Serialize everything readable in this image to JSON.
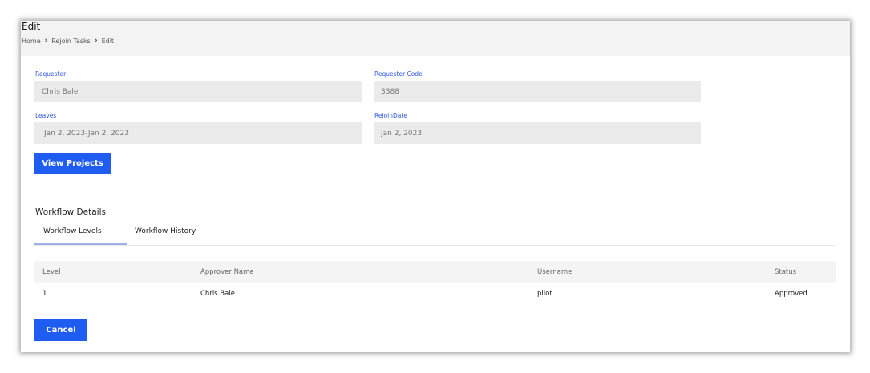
{
  "page": {
    "title": "Edit",
    "breadcrumb": [
      "Home",
      "Rejoin Tasks",
      "Edit"
    ]
  },
  "form": {
    "requester": {
      "label": "Requester",
      "value": "Chris Bale"
    },
    "requester_code": {
      "label": "Requester Code",
      "value": "3388"
    },
    "leaves": {
      "label": "Leaves",
      "value": "Jan 2, 2023-Jan 2, 2023"
    },
    "rejoin_date": {
      "label": "RejoinDate",
      "value": "Jan 2, 2023"
    }
  },
  "buttons": {
    "view_projects": "View Projects",
    "cancel": "Cancel"
  },
  "workflow": {
    "title": "Workflow Details",
    "tabs": [
      {
        "label": "Workflow Levels",
        "active": true
      },
      {
        "label": "Workflow History",
        "active": false
      }
    ],
    "columns": [
      "Level",
      "Approver Name",
      "Username",
      "Status"
    ],
    "rows": [
      {
        "level": "1",
        "approver_name": "Chris Bale",
        "username": "pilot",
        "status": "Approved"
      }
    ]
  },
  "colors": {
    "accent": "#1e5cf2",
    "label": "#2f5be0",
    "input_bg": "#ebebeb"
  }
}
